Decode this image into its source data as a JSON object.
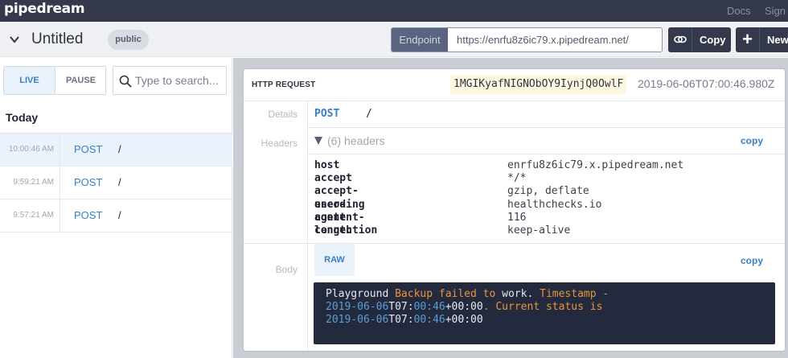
{
  "app": {
    "logo": "pipedream",
    "nav": {
      "docs": "Docs",
      "sign": "Sign"
    }
  },
  "titlebar": {
    "title": "Untitled",
    "badge": "public",
    "endpoint_label": "Endpoint",
    "endpoint_url": "https://enrfu8z6ic79.x.pipedream.net/",
    "copy_label": "Copy",
    "new_label": "New"
  },
  "sidebar": {
    "live_label": "LIVE",
    "pause_label": "PAUSE",
    "search_placeholder": "Type to search...",
    "group_label": "Today",
    "events": [
      {
        "time": "10:00:46 AM",
        "method": "POST",
        "path": "/"
      },
      {
        "time": "9:59:21 AM",
        "method": "POST",
        "path": "/"
      },
      {
        "time": "9:57:21 AM",
        "method": "POST",
        "path": "/"
      }
    ]
  },
  "request": {
    "header_label": "HTTP REQUEST",
    "id": "1MGIKyafNIGNObOY9IynjQ0OwlF",
    "timestamp": "2019-06-06T07:00:46.980Z",
    "labels": {
      "details": "Details",
      "headers": "Headers",
      "body": "Body"
    },
    "method": "POST",
    "path": "/",
    "headers_summary": "(6) headers",
    "copy_label": "copy",
    "headers": [
      {
        "key": "host",
        "value": "enrfu8z6ic79.x.pipedream.net"
      },
      {
        "key": "accept",
        "value": "*/*"
      },
      {
        "key": "accept-encoding",
        "value": "gzip, deflate"
      },
      {
        "key": "user-agent",
        "value": "healthchecks.io"
      },
      {
        "key": "content-length",
        "value": "116"
      },
      {
        "key": "connection",
        "value": "keep-alive"
      }
    ],
    "body_tab": "RAW",
    "body": {
      "l1_a": "Playground ",
      "l1_b": "Backup failed to",
      "l1_c": " work. ",
      "l1_d": "Timestamp -",
      "l2_a": "2019-06-06",
      "l2_b": "T07:",
      "l2_c": "00:46",
      "l2_d": "+00:00",
      "l2_e": ". Current status is",
      "l3_a": "2019-06-06",
      "l3_b": "T07:",
      "l3_c": "00:46",
      "l3_d": "+00:00"
    }
  },
  "colors": {
    "topbar": "#343a4c",
    "accent": "#3a7fc2",
    "code_bg": "#232a3d",
    "highlight": "#fdf7e0"
  }
}
